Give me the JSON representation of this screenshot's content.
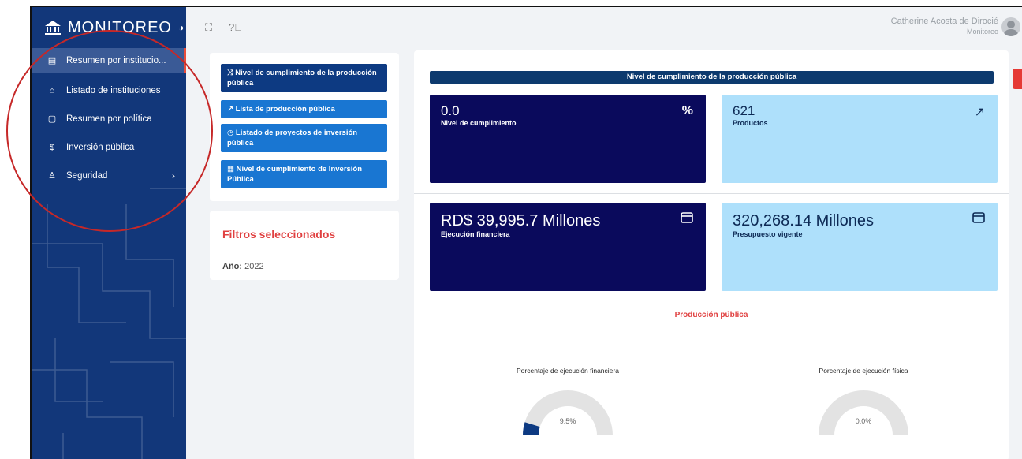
{
  "sidebar": {
    "brand": "MONITOREO",
    "items": [
      {
        "label": "Resumen por institucio...",
        "icon": "document-icon"
      },
      {
        "label": "Listado de instituciones",
        "icon": "building-icon"
      },
      {
        "label": "Resumen por política",
        "icon": "clipboard-icon"
      },
      {
        "label": "Inversión pública",
        "icon": "dollar-icon"
      },
      {
        "label": "Seguridad",
        "icon": "user-icon"
      }
    ]
  },
  "topbar": {
    "user_name": "Catherine Acosta de Dirocié",
    "user_role": "Monitoreo"
  },
  "links": [
    {
      "label": "⤨ Nivel de cumplimiento de la producción pública"
    },
    {
      "label": "↗ Lista de producción pública"
    },
    {
      "label": "◷ Listado de proyectos de inversión pública"
    },
    {
      "label": "▦ Nivel de cumplimiento de Inversión Pública"
    }
  ],
  "filters": {
    "title": "Filtros seleccionados",
    "year_label": "Año:",
    "year_value": "2022"
  },
  "main": {
    "header": "Nivel de cumplimiento de la producción pública",
    "kpis": [
      {
        "value": "0.0",
        "label": "Nivel de cumplimiento",
        "icon": "percent-icon"
      },
      {
        "value": "621",
        "label": "Productos",
        "icon": "trending-up-icon"
      },
      {
        "value": "RD$ 39,995.7 Millones",
        "label": "Ejecución financiera",
        "icon": "card-icon"
      },
      {
        "value": "320,268.14 Millones",
        "label": "Presupuesto vigente",
        "icon": "card-icon"
      }
    ],
    "section_title": "Producción pública",
    "gauges": [
      {
        "title": "Porcentaje de ejecución financiera",
        "value_text": "9.5%",
        "value": 9.5
      },
      {
        "title": "Porcentaje de ejecución física",
        "value_text": "0.0%",
        "value": 0.0
      }
    ]
  },
  "colors": {
    "sidebar": "#12377a",
    "kpi_dark": "#0a0a5c",
    "kpi_light": "#aee0fb",
    "accent_red": "#e04040",
    "link_blue": "#1976d2"
  }
}
